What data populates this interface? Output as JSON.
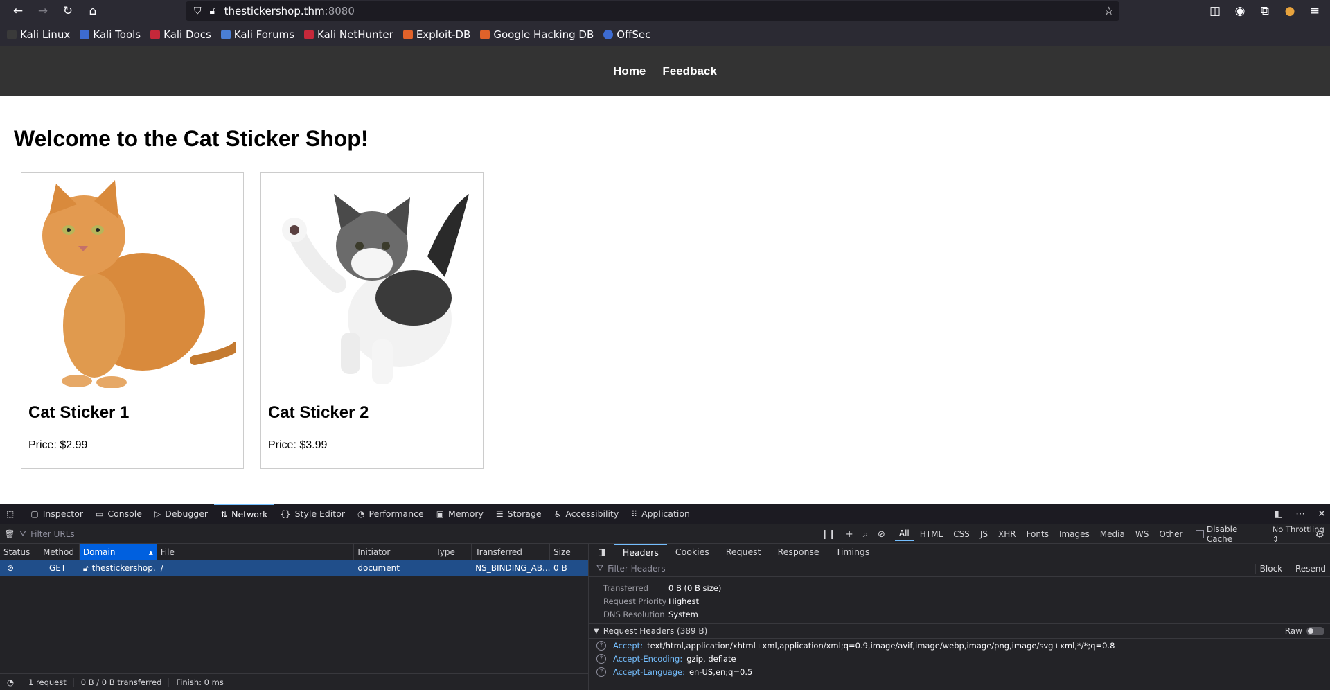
{
  "browser": {
    "url_host": "thestickershop.thm",
    "url_port": ":8080",
    "bookmarks": [
      "Kali Linux",
      "Kali Tools",
      "Kali Docs",
      "Kali Forums",
      "Kali NetHunter",
      "Exploit-DB",
      "Google Hacking DB",
      "OffSec"
    ]
  },
  "site": {
    "nav": [
      "Home",
      "Feedback"
    ],
    "title": "Welcome to the Cat Sticker Shop!",
    "products": [
      {
        "name": "Cat Sticker 1",
        "price": "Price: $2.99"
      },
      {
        "name": "Cat Sticker 2",
        "price": "Price: $3.99"
      }
    ]
  },
  "devtools": {
    "tabs": [
      "Inspector",
      "Console",
      "Debugger",
      "Network",
      "Style Editor",
      "Performance",
      "Memory",
      "Storage",
      "Accessibility",
      "Application"
    ],
    "filter_placeholder": "Filter URLs",
    "type_filters": [
      "All",
      "HTML",
      "CSS",
      "JS",
      "XHR",
      "Fonts",
      "Images",
      "Media",
      "WS",
      "Other"
    ],
    "disable_cache": "Disable Cache",
    "throttling": "No Throttling ⇕",
    "columns": [
      "Status",
      "Method",
      "Domain",
      "File",
      "Initiator",
      "Type",
      "Transferred",
      "Size"
    ],
    "request": {
      "method": "GET",
      "domain": "thestickershop....",
      "file": "/",
      "initiator": "document",
      "type": "",
      "transferred": "NS_BINDING_AB...",
      "size": "0 B"
    },
    "status_bar": [
      "1 request",
      "0 B / 0 B transferred",
      "Finish: 0 ms"
    ],
    "detail_tabs": [
      "Headers",
      "Cookies",
      "Request",
      "Response",
      "Timings"
    ],
    "filter_headers": "Filter Headers",
    "block_label": "Block",
    "resend_label": "Resend",
    "summary": [
      {
        "k": "Transferred",
        "v": "0 B (0 B size)"
      },
      {
        "k": "Request Priority",
        "v": "Highest"
      },
      {
        "k": "DNS Resolution",
        "v": "System"
      }
    ],
    "request_headers_title": "Request Headers (389 B)",
    "raw_label": "Raw",
    "headers": [
      {
        "k": "Accept:",
        "v": "text/html,application/xhtml+xml,application/xml;q=0.9,image/avif,image/webp,image/png,image/svg+xml,*/*;q=0.8"
      },
      {
        "k": "Accept-Encoding:",
        "v": "gzip, deflate"
      },
      {
        "k": "Accept-Language:",
        "v": "en-US,en;q=0.5"
      }
    ]
  }
}
